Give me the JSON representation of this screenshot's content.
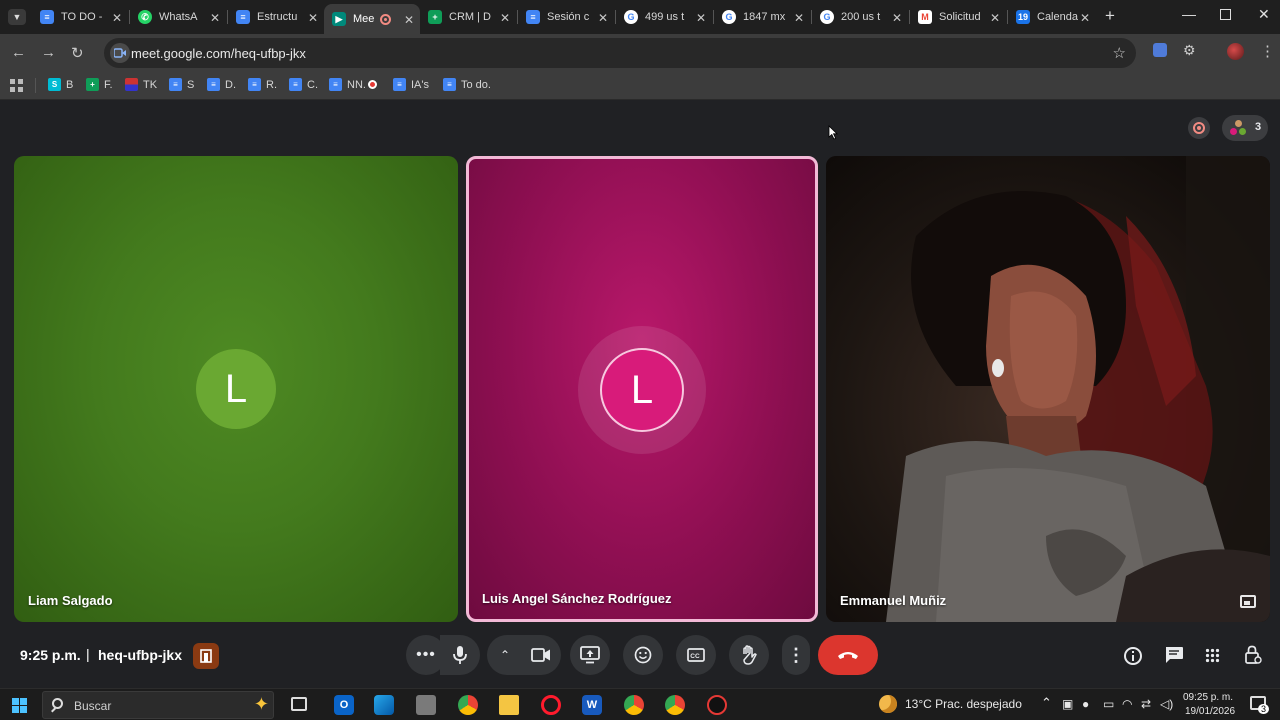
{
  "browser": {
    "tabs": [
      {
        "title": "TO DO -",
        "icon": "google-docs-icon",
        "color": "#4285f4"
      },
      {
        "title": "WhatsA",
        "icon": "whatsapp-icon",
        "color": "#25d366"
      },
      {
        "title": "Estructu",
        "icon": "google-docs-icon",
        "color": "#4285f4"
      },
      {
        "title": "Mee",
        "icon": "google-meet-icon",
        "color": "#00897b",
        "active": true
      },
      {
        "title": "CRM | D",
        "icon": "google-sheets-icon",
        "color": "#0f9d58"
      },
      {
        "title": "Sesión c",
        "icon": "google-docs-icon",
        "color": "#4285f4"
      },
      {
        "title": "499 us t",
        "icon": "google-icon",
        "color": "#ffffff"
      },
      {
        "title": "1847 mx",
        "icon": "google-icon",
        "color": "#ffffff"
      },
      {
        "title": "200 us t",
        "icon": "google-icon",
        "color": "#ffffff"
      },
      {
        "title": "Solicitud",
        "icon": "gmail-icon",
        "color": "#ea4335"
      },
      {
        "title": "Calenda",
        "icon": "google-calendar-icon",
        "color": "#1a73e8"
      }
    ],
    "new_tab_label": "+",
    "url": "meet.google.com/heq-ufbp-jkx",
    "bookmarks": [
      {
        "label": "B",
        "icon": "grid-bookmark-icon",
        "color": "#00bcd4"
      },
      {
        "label": "F.",
        "icon": "sheets-bookmark-icon",
        "color": "#0f9d58"
      },
      {
        "label": "TK",
        "icon": "flag-bookmark-icon",
        "color": "#8e24aa"
      },
      {
        "label": "S",
        "icon": "docs-bookmark-icon",
        "color": "#4285f4"
      },
      {
        "label": "D.",
        "icon": "docs-bookmark-icon",
        "color": "#4285f4"
      },
      {
        "label": "R.",
        "icon": "docs-bookmark-icon",
        "color": "#4285f4"
      },
      {
        "label": "C.",
        "icon": "docs-bookmark-icon",
        "color": "#4285f4"
      },
      {
        "label": "NN.",
        "icon": "docs-bookmark-icon",
        "color": "#4285f4"
      },
      {
        "label": "IA's",
        "icon": "docs-bookmark-icon",
        "color": "#4285f4"
      },
      {
        "label": "To do.",
        "icon": "docs-bookmark-icon",
        "color": "#4285f4"
      }
    ]
  },
  "meet": {
    "participant_count": "3",
    "participants": [
      {
        "name": "Liam Salgado",
        "initial": "L",
        "avatar_color": "#6aa832"
      },
      {
        "name": "Luis Angel Sánchez Rodríguez",
        "initial": "L",
        "avatar_color": "#d81b7a",
        "speaking": true
      },
      {
        "name": "Emmanuel Muñiz",
        "initial": "",
        "video": true
      }
    ],
    "time": "9:25 p.m.",
    "separator": "|",
    "meeting_code": "heq-ufbp-jkx"
  },
  "taskbar": {
    "search_placeholder": "Buscar",
    "weather": "13°C  Prac. despejado",
    "clock_time": "09:25 p. m.",
    "clock_date": "19/01/2026",
    "notification_count": "3"
  }
}
